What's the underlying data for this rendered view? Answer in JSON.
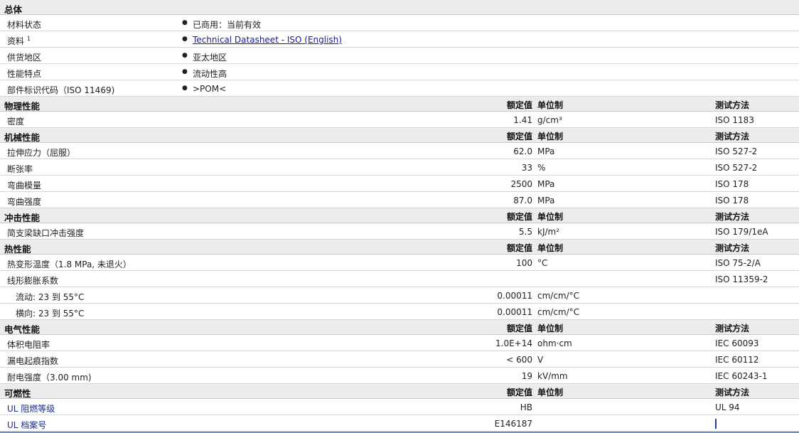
{
  "general": {
    "header": "总体",
    "rows": [
      {
        "label": "材料状态",
        "value": "已商用：当前有效"
      },
      {
        "label": "资料",
        "sup": "1",
        "link": "Technical Datasheet - ISO (English)"
      },
      {
        "label": "供货地区",
        "value": "亚太地区"
      },
      {
        "label": "性能特点",
        "value": "流动性高"
      },
      {
        "label": "部件标识代码（ISO 11469)",
        "value": ">POM<"
      }
    ]
  },
  "col_headers": {
    "value": "额定值",
    "unit": "单位制",
    "test": "测试方法"
  },
  "physical": {
    "header": "物理性能",
    "rows": [
      {
        "label": "密度",
        "value": "1.41",
        "unit": "g/cm³",
        "test": "ISO 1183"
      }
    ]
  },
  "mechanical": {
    "header": "机械性能",
    "rows": [
      {
        "label": "拉伸应力（屈服）",
        "value": "62.0",
        "unit": "MPa",
        "test": "ISO 527-2"
      },
      {
        "label": "断张率",
        "value": "33",
        "unit": "%",
        "test": "ISO 527-2"
      },
      {
        "label": "弯曲模量",
        "value": "2500",
        "unit": "MPa",
        "test": "ISO 178"
      },
      {
        "label": "弯曲强度",
        "value": "87.0",
        "unit": "MPa",
        "test": "ISO 178"
      }
    ]
  },
  "impact": {
    "header": "冲击性能",
    "rows": [
      {
        "label": "简支梁缺口冲击强度",
        "value": "5.5",
        "unit": "kJ/m²",
        "test": "ISO 179/1eA"
      }
    ]
  },
  "thermal": {
    "header": "热性能",
    "rows": [
      {
        "label": "热变形温度（1.8 MPa, 未退火）",
        "value": "100",
        "unit": "°C",
        "test": "ISO 75-2/A"
      },
      {
        "label": "线形膨胀系数",
        "value": "",
        "unit": "",
        "test": "ISO 11359-2"
      },
      {
        "label": "流动: 23 到  55°C",
        "value": "0.00011",
        "unit": "cm/cm/°C",
        "test": ""
      },
      {
        "label": "横向: 23 到  55°C",
        "value": "0.00011",
        "unit": "cm/cm/°C",
        "test": ""
      }
    ]
  },
  "electrical": {
    "header": "电气性能",
    "rows": [
      {
        "label": "体积电阻率",
        "value": "1.0E+14",
        "unit": "ohm·cm",
        "test": "IEC 60093"
      },
      {
        "label": "漏电起痕指数",
        "value": "< 600",
        "unit": "V",
        "test": "IEC 60112"
      },
      {
        "label": "耐电强度（3.00 mm)",
        "value": "19",
        "unit": "kV/mm",
        "test": "IEC 60243-1"
      }
    ]
  },
  "flammability": {
    "header": "可燃性",
    "rows": [
      {
        "label": "UL 阻燃等级",
        "value": "HB",
        "unit": "",
        "test": "UL 94"
      },
      {
        "label": "UL 档案号",
        "value": "E146187",
        "unit": "",
        "test": ""
      }
    ]
  }
}
